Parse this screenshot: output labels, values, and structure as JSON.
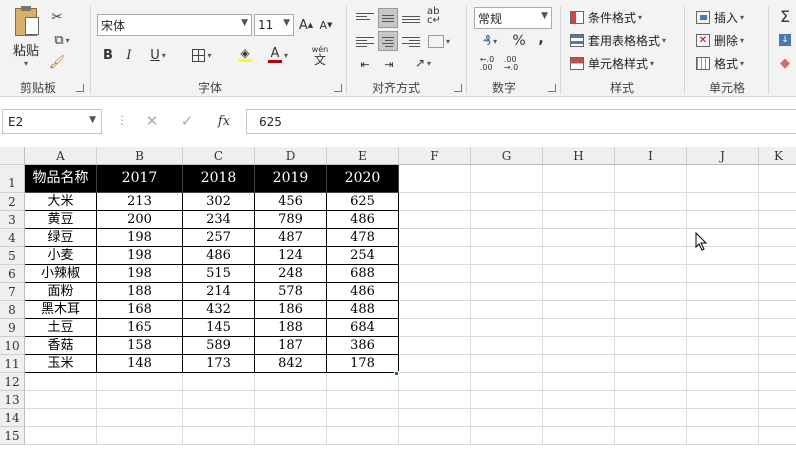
{
  "ribbon": {
    "clipboard": {
      "paste_label": "粘贴",
      "group_label": "剪贴板"
    },
    "font": {
      "font_name": "宋体",
      "font_size": "11",
      "group_label": "字体",
      "bold": "B",
      "italic": "I",
      "underline": "U",
      "phonetic": "wén",
      "phonetic_char": "文"
    },
    "alignment": {
      "group_label": "对齐方式"
    },
    "number": {
      "format": "常规",
      "group_label": "数字",
      "percent": "%",
      "comma": ","
    },
    "styles": {
      "conditional": "条件格式",
      "table": "套用表格格式",
      "cell": "单元格样式",
      "group_label": "样式"
    },
    "cells": {
      "insert": "插入",
      "delete": "删除",
      "format": "格式",
      "group_label": "单元格"
    }
  },
  "formula_bar": {
    "name_box": "E2",
    "fx": "fx",
    "value": "625"
  },
  "columns": [
    "A",
    "B",
    "C",
    "D",
    "E",
    "F",
    "G",
    "H",
    "I",
    "J",
    "K"
  ],
  "rows": [
    "1",
    "2",
    "3",
    "4",
    "5",
    "6",
    "7",
    "8",
    "9",
    "10",
    "11",
    "12",
    "13",
    "14",
    "15"
  ],
  "table": {
    "header": [
      "物品名称",
      "2017",
      "2018",
      "2019",
      "2020"
    ],
    "body": [
      [
        "大米",
        "213",
        "302",
        "456",
        "625"
      ],
      [
        "黄豆",
        "200",
        "234",
        "789",
        "486"
      ],
      [
        "绿豆",
        "198",
        "257",
        "487",
        "478"
      ],
      [
        "小麦",
        "198",
        "486",
        "124",
        "254"
      ],
      [
        "小辣椒",
        "198",
        "515",
        "248",
        "688"
      ],
      [
        "面粉",
        "188",
        "214",
        "578",
        "486"
      ],
      [
        "黑木耳",
        "168",
        "432",
        "186",
        "488"
      ],
      [
        "土豆",
        "165",
        "145",
        "188",
        "684"
      ],
      [
        "香菇",
        "158",
        "589",
        "187",
        "386"
      ],
      [
        "玉米",
        "148",
        "173",
        "842",
        "178"
      ]
    ]
  },
  "colors": {
    "header_bg": "#000000",
    "header_fg": "#ffffff",
    "accent": "#217346"
  }
}
